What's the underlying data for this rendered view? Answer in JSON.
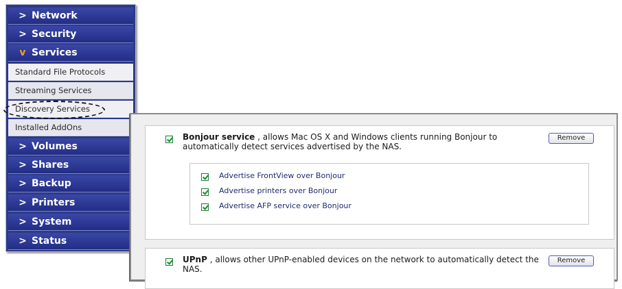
{
  "sidebar": {
    "items": [
      {
        "label": "Network"
      },
      {
        "label": "Security"
      },
      {
        "label": "Services"
      },
      {
        "label": "Standard File Protocols"
      },
      {
        "label": "Streaming Services"
      },
      {
        "label": "Discovery Services"
      },
      {
        "label": "Installed AddOns"
      },
      {
        "label": "Volumes"
      },
      {
        "label": "Shares"
      },
      {
        "label": "Backup"
      },
      {
        "label": "Printers"
      },
      {
        "label": "System"
      },
      {
        "label": "Status"
      }
    ],
    "collapsed_chevron": ">",
    "expanded_chevron": "v",
    "highlighted_item": "Discovery Services"
  },
  "bonjour": {
    "checked": true,
    "title": "Bonjour service",
    "description": ", allows Mac OS X and Windows clients running Bonjour to automatically detect services advertised by the NAS.",
    "remove_label": "Remove",
    "options": [
      {
        "label": "Advertise FrontView over Bonjour",
        "checked": true
      },
      {
        "label": "Advertise printers over Bonjour",
        "checked": true
      },
      {
        "label": "Advertise AFP service over Bonjour",
        "checked": true
      }
    ]
  },
  "upnp": {
    "checked": true,
    "title": "UPnP",
    "description": ", allows other UPnP-enabled devices on the network to automatically detect the NAS.",
    "remove_label": "Remove"
  },
  "colors": {
    "nav_blue": "#2d3a88",
    "expanded_chevron": "#f2a01e",
    "checkbox_green": "#1a8a2e"
  }
}
